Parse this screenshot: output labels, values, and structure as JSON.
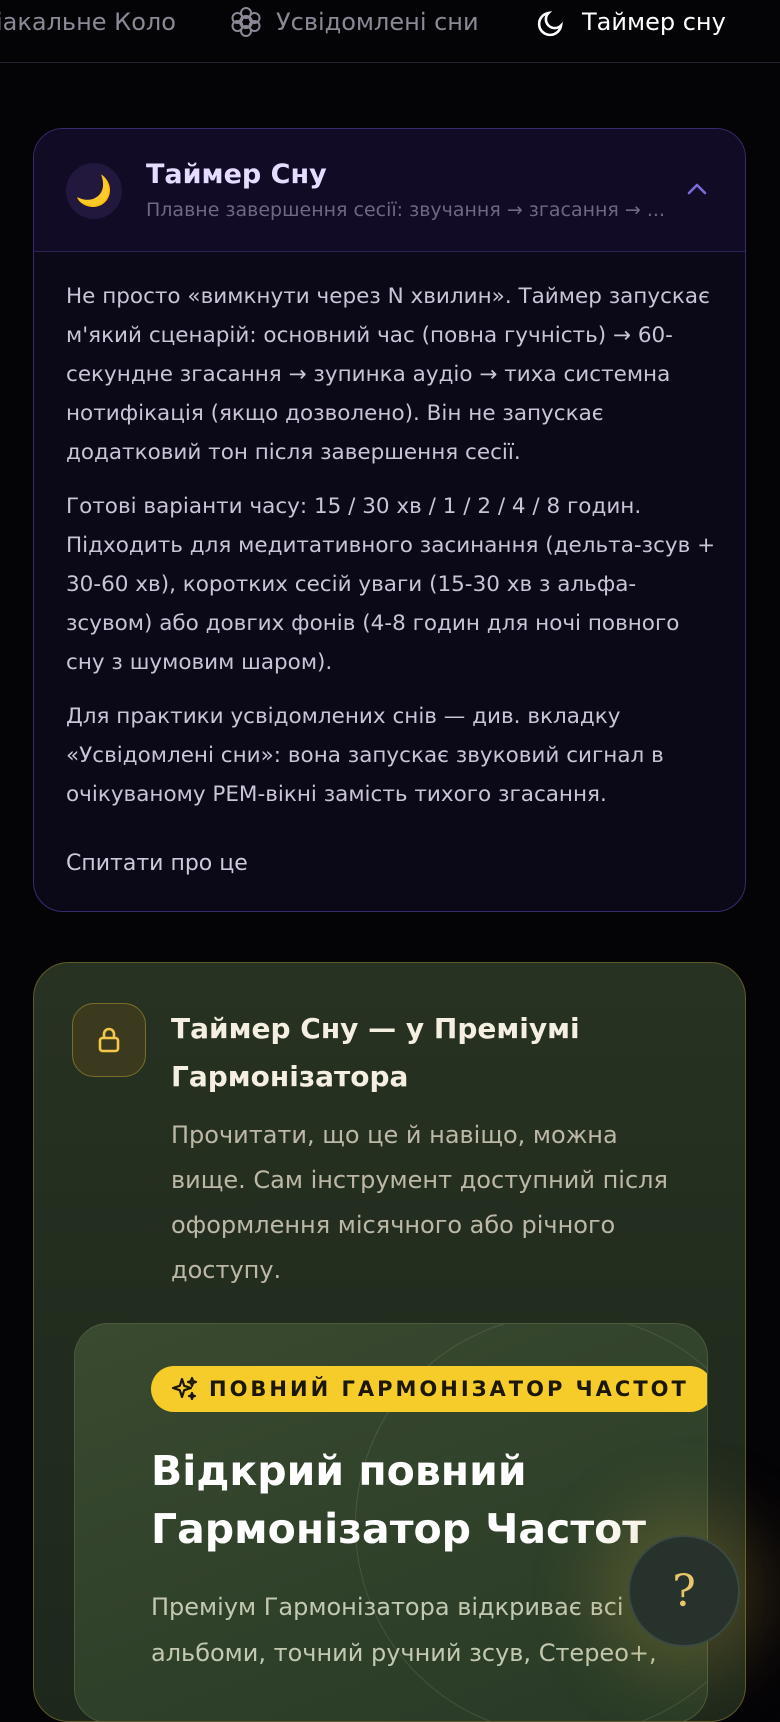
{
  "tabs": [
    {
      "label": "іакальне Коло",
      "icon": "none"
    },
    {
      "label": "Усвідомлені сни",
      "icon": "brain-icon"
    },
    {
      "label": "Таймер сну",
      "icon": "moon-icon",
      "active": true
    }
  ],
  "sleep_card": {
    "title": "Таймер Сну",
    "subtitle": "Плавне завершення сесії: звучання → згасання → ...",
    "paragraphs": [
      "Не просто «вимкнути через N хвилин». Таймер запускає м'який сценарій: основний час (повна гучність) → 60-секундне згасання → зупинка аудіо → тиха системна нотифікація (якщо дозволено). Він не запускає додатковий тон після завершення сесії.",
      "Готові варіанти часу: 15 / 30 хв / 1 / 2 / 4 / 8 годин. Підходить для медитативного засинання (дельта-зсув + 30-60 хв), коротких сесій уваги (15-30 хв з альфа-зсувом) або довгих фонів (4-8 годин для ночі повного сну з шумовим шаром).",
      "Для практики усвідомлених снів — див. вкладку «Усвідомлені сни»: вона запускає звуковий сигнал в очікуваному РЕМ-вікні замість тихого згасання."
    ],
    "ask_label": "Спитати про це"
  },
  "premium": {
    "title": "Таймер Сну — у Преміумі Гармонізатора",
    "description": "Прочитати, що це й навіщо, можна вище. Сам інструмент доступний після оформлення місячного або річного доступу.",
    "badge": "ПОВНИЙ ГАРМОНІЗАТОР ЧАСТОТ",
    "heading": "Відкрий повний Гармонізатор Частот",
    "text": "Преміум Гармонізатора відкриває всі пла альбоми, точний ручний зсув, Стерео+,"
  },
  "help_button": "?",
  "colors": {
    "accent_gold": "#f6cc2a",
    "accent_violet": "#8b7cf0",
    "background": "#040306"
  }
}
